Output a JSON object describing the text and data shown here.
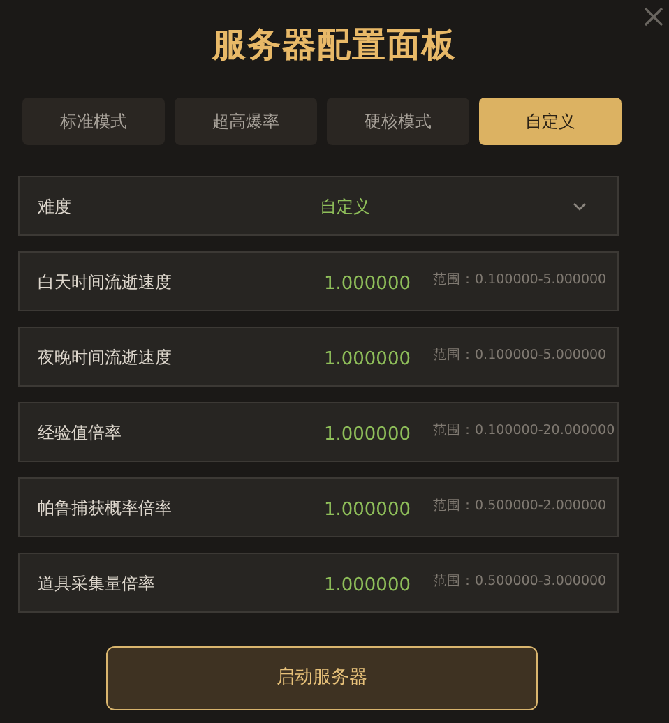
{
  "title": "服务器配置面板",
  "tabs": [
    {
      "label": "标准模式",
      "selected": false
    },
    {
      "label": "超高爆率",
      "selected": false
    },
    {
      "label": "硬核模式",
      "selected": false
    },
    {
      "label": "自定义",
      "selected": true
    }
  ],
  "difficulty": {
    "label": "难度",
    "value": "自定义"
  },
  "settings": [
    {
      "label": "白天时间流逝速度",
      "value": "1.000000",
      "range": "范围：0.100000-5.000000"
    },
    {
      "label": "夜晚时间流逝速度",
      "value": "1.000000",
      "range": "范围：0.100000-5.000000"
    },
    {
      "label": "经验值倍率",
      "value": "1.000000",
      "range": "范围：0.100000-20.000000"
    },
    {
      "label": "帕鲁捕获概率倍率",
      "value": "1.000000",
      "range": "范围：0.500000-2.000000"
    },
    {
      "label": "道具采集量倍率",
      "value": "1.000000",
      "range": "范围：0.500000-3.000000"
    }
  ],
  "start_button": "启动服务器"
}
